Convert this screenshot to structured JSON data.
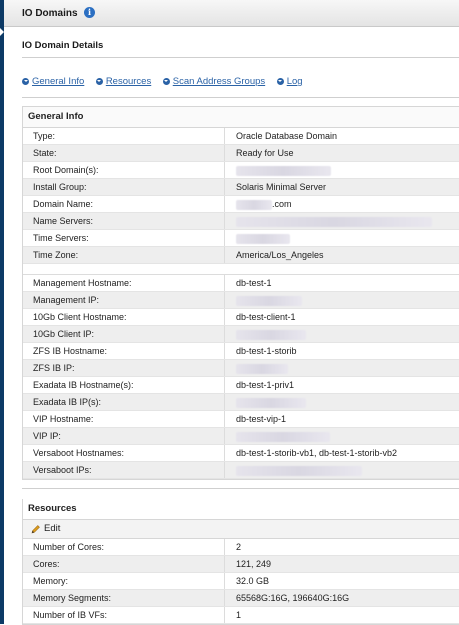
{
  "header": {
    "title": "IO Domains",
    "info_icon": "i"
  },
  "details": {
    "title": "IO Domain Details"
  },
  "links": [
    {
      "label": "General Info"
    },
    {
      "label": "Resources"
    },
    {
      "label": "Scan Address Groups"
    },
    {
      "label": "Log"
    }
  ],
  "general_info": {
    "title": "General Info",
    "group1": [
      {
        "label": "Type:",
        "value": "Oracle Database Domain"
      },
      {
        "label": "State:",
        "value": "Ready for Use"
      },
      {
        "label": "Root Domain(s):",
        "value": ""
      },
      {
        "label": "Install Group:",
        "value": "Solaris Minimal Server"
      },
      {
        "label": "Domain Name:",
        "value": ".com"
      },
      {
        "label": "Name Servers:",
        "value": ""
      },
      {
        "label": "Time Servers:",
        "value": ""
      },
      {
        "label": "Time Zone:",
        "value": "America/Los_Angeles"
      }
    ],
    "group2": [
      {
        "label": "Management Hostname:",
        "value": "db-test-1"
      },
      {
        "label": "Management IP:",
        "value": ""
      },
      {
        "label": "10Gb Client Hostname:",
        "value": "db-test-client-1"
      },
      {
        "label": "10Gb Client IP:",
        "value": ""
      },
      {
        "label": "ZFS IB Hostname:",
        "value": "db-test-1-storib"
      },
      {
        "label": "ZFS IB IP:",
        "value": ""
      },
      {
        "label": "Exadata IB Hostname(s):",
        "value": "db-test-1-priv1"
      },
      {
        "label": "Exadata IB IP(s):",
        "value": ""
      },
      {
        "label": "VIP Hostname:",
        "value": "db-test-vip-1"
      },
      {
        "label": "VIP IP:",
        "value": ""
      },
      {
        "label": "Versaboot Hostnames:",
        "value": "db-test-1-storib-vb1, db-test-1-storib-vb2"
      },
      {
        "label": "Versaboot IPs:",
        "value": ""
      }
    ]
  },
  "resources": {
    "title": "Resources",
    "edit_label": "Edit",
    "rows": [
      {
        "label": "Number of Cores:",
        "value": "2"
      },
      {
        "label": "Cores:",
        "value": "121, 249"
      },
      {
        "label": "Memory:",
        "value": "32.0 GB"
      },
      {
        "label": "Memory Segments:",
        "value": "65568G:16G, 196640G:16G"
      },
      {
        "label": "Number of IB VFs:",
        "value": "1"
      }
    ]
  },
  "colors": {
    "accent": "#2a62a6",
    "sidebar": "#0d3a66",
    "row_alt": "#eeeeee"
  }
}
